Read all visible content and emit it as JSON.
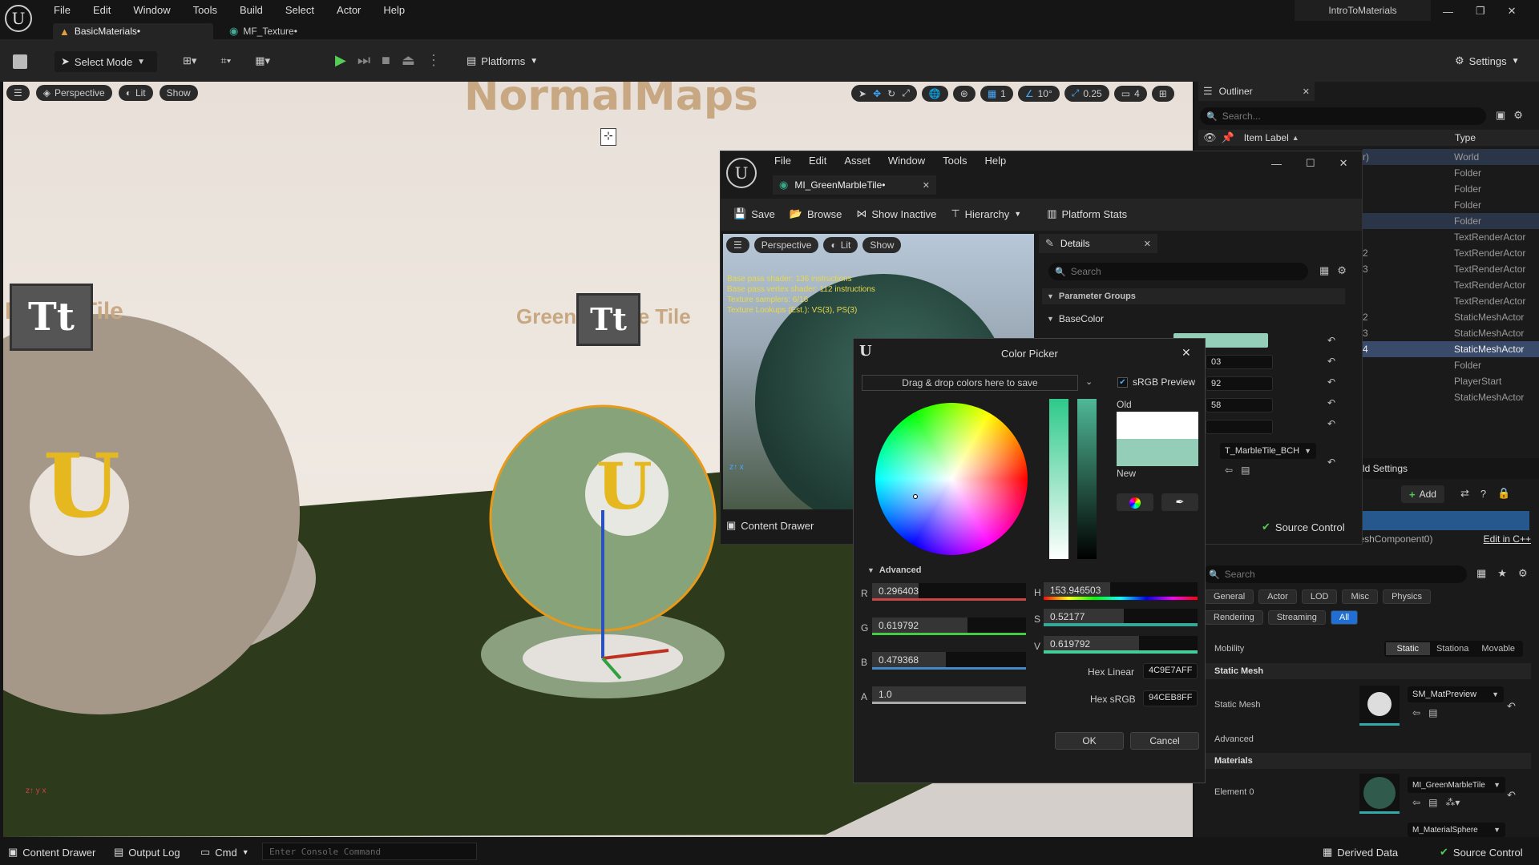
{
  "main_menu": {
    "items": [
      "File",
      "Edit",
      "Window",
      "Tools",
      "Build",
      "Select",
      "Actor",
      "Help"
    ]
  },
  "project_name": "IntroToMaterials",
  "tabs": [
    {
      "label": "BasicMaterials•"
    },
    {
      "label": "MF_Texture•"
    }
  ],
  "toolbar": {
    "select_mode": "Select Mode",
    "platforms": "Platforms",
    "settings": "Settings"
  },
  "viewport": {
    "perspective": "Perspective",
    "lit": "Lit",
    "show": "Show",
    "snap_grid": "1",
    "snap_angle": "10°",
    "snap_scale": "0.25",
    "camera_speed": "4",
    "scene_text_top": "NormalMaps",
    "scene_text_left": "MarbleTile",
    "scene_text_right": "Green Marble Tile"
  },
  "outliner": {
    "title": "Outliner",
    "search_placeholder": "Search...",
    "col_label": "Item Label",
    "col_type": "Type",
    "left_fragments": [
      "r)",
      "",
      "",
      "",
      "",
      "",
      "2",
      "3",
      "",
      "",
      "2",
      "3",
      "4",
      "",
      "",
      ""
    ],
    "types": [
      "World",
      "Folder",
      "Folder",
      "Folder",
      "Folder",
      "TextRenderActor",
      "TextRenderActor",
      "TextRenderActor",
      "TextRenderActor",
      "TextRenderActor",
      "StaticMeshActor",
      "StaticMeshActor",
      "StaticMeshActor",
      "Folder",
      "PlayerStart",
      "StaticMeshActor"
    ]
  },
  "world_settings": "ld Settings",
  "details_panel": {
    "add": "Add",
    "component": "StaticMeshComponent0 (StaticMeshComponent0)",
    "edit_in_cpp": "Edit in C++",
    "search_placeholder": "Search",
    "filter_tabs": [
      "General",
      "Actor",
      "LOD",
      "Misc",
      "Physics",
      "Rendering",
      "Streaming",
      "All"
    ],
    "mobility_label": "Mobility",
    "mobility_options": [
      "Static",
      "Stationa",
      "Movable"
    ],
    "static_mesh_section": "Static Mesh",
    "static_mesh_label": "Static Mesh",
    "static_mesh_value": "SM_MatPreview",
    "advanced": "Advanced",
    "materials_section": "Materials",
    "element0": "Element 0",
    "element0_value": "MI_GreenMarbleTile",
    "element1_value": "M_MaterialSphere"
  },
  "material_editor": {
    "menu": [
      "File",
      "Edit",
      "Asset",
      "Window",
      "Tools",
      "Help"
    ],
    "tab": "MI_GreenMarbleTile•",
    "toolbar": [
      "Save",
      "Browse",
      "Show Inactive",
      "Hierarchy",
      "Platform Stats"
    ],
    "preview": {
      "perspective": "Perspective",
      "lit": "Lit",
      "show": "Show",
      "stats": [
        "Base pass shader: 136 instructions",
        "Base pass vertex shader: 112 instructions",
        "Texture samplers: 6/16",
        "Texture Lookups (Est.): VS(3), PS(3)"
      ]
    },
    "content_drawer": "Content Drawer",
    "details_title": "Details",
    "search_placeholder": "Search",
    "param_groups": "Parameter Groups",
    "base_color": "BaseColor",
    "param_values": [
      "03",
      "92",
      "58",
      ""
    ],
    "texture_value": "T_MarbleTile_BCH",
    "source_control": "Source Control"
  },
  "color_picker": {
    "title": "Color Picker",
    "drag_text": "Drag & drop colors here to save",
    "srgb_preview": "sRGB Preview",
    "old_label": "Old",
    "new_label": "New",
    "old_color": "#FFFFFF",
    "new_color": "#94CEB8",
    "advanced": "Advanced",
    "r_label": "R",
    "r": "0.296403",
    "g_label": "G",
    "g": "0.619792",
    "b_label": "B",
    "b": "0.479368",
    "a_label": "A",
    "a": "1.0",
    "h_label": "H",
    "h": "153.946503",
    "s_label": "S",
    "s": "0.52177",
    "v_label": "V",
    "v": "0.619792",
    "hex_linear_label": "Hex Linear",
    "hex_linear": "4C9E7AFF",
    "hex_srgb_label": "Hex sRGB",
    "hex_srgb": "94CEB8FF",
    "ok": "OK",
    "cancel": "Cancel"
  },
  "status_bar": {
    "content_drawer": "Content Drawer",
    "output_log": "Output Log",
    "cmd": "Cmd",
    "console_placeholder": "Enter Console Command",
    "derived_data": "Derived Data",
    "source_control": "Source Control"
  }
}
